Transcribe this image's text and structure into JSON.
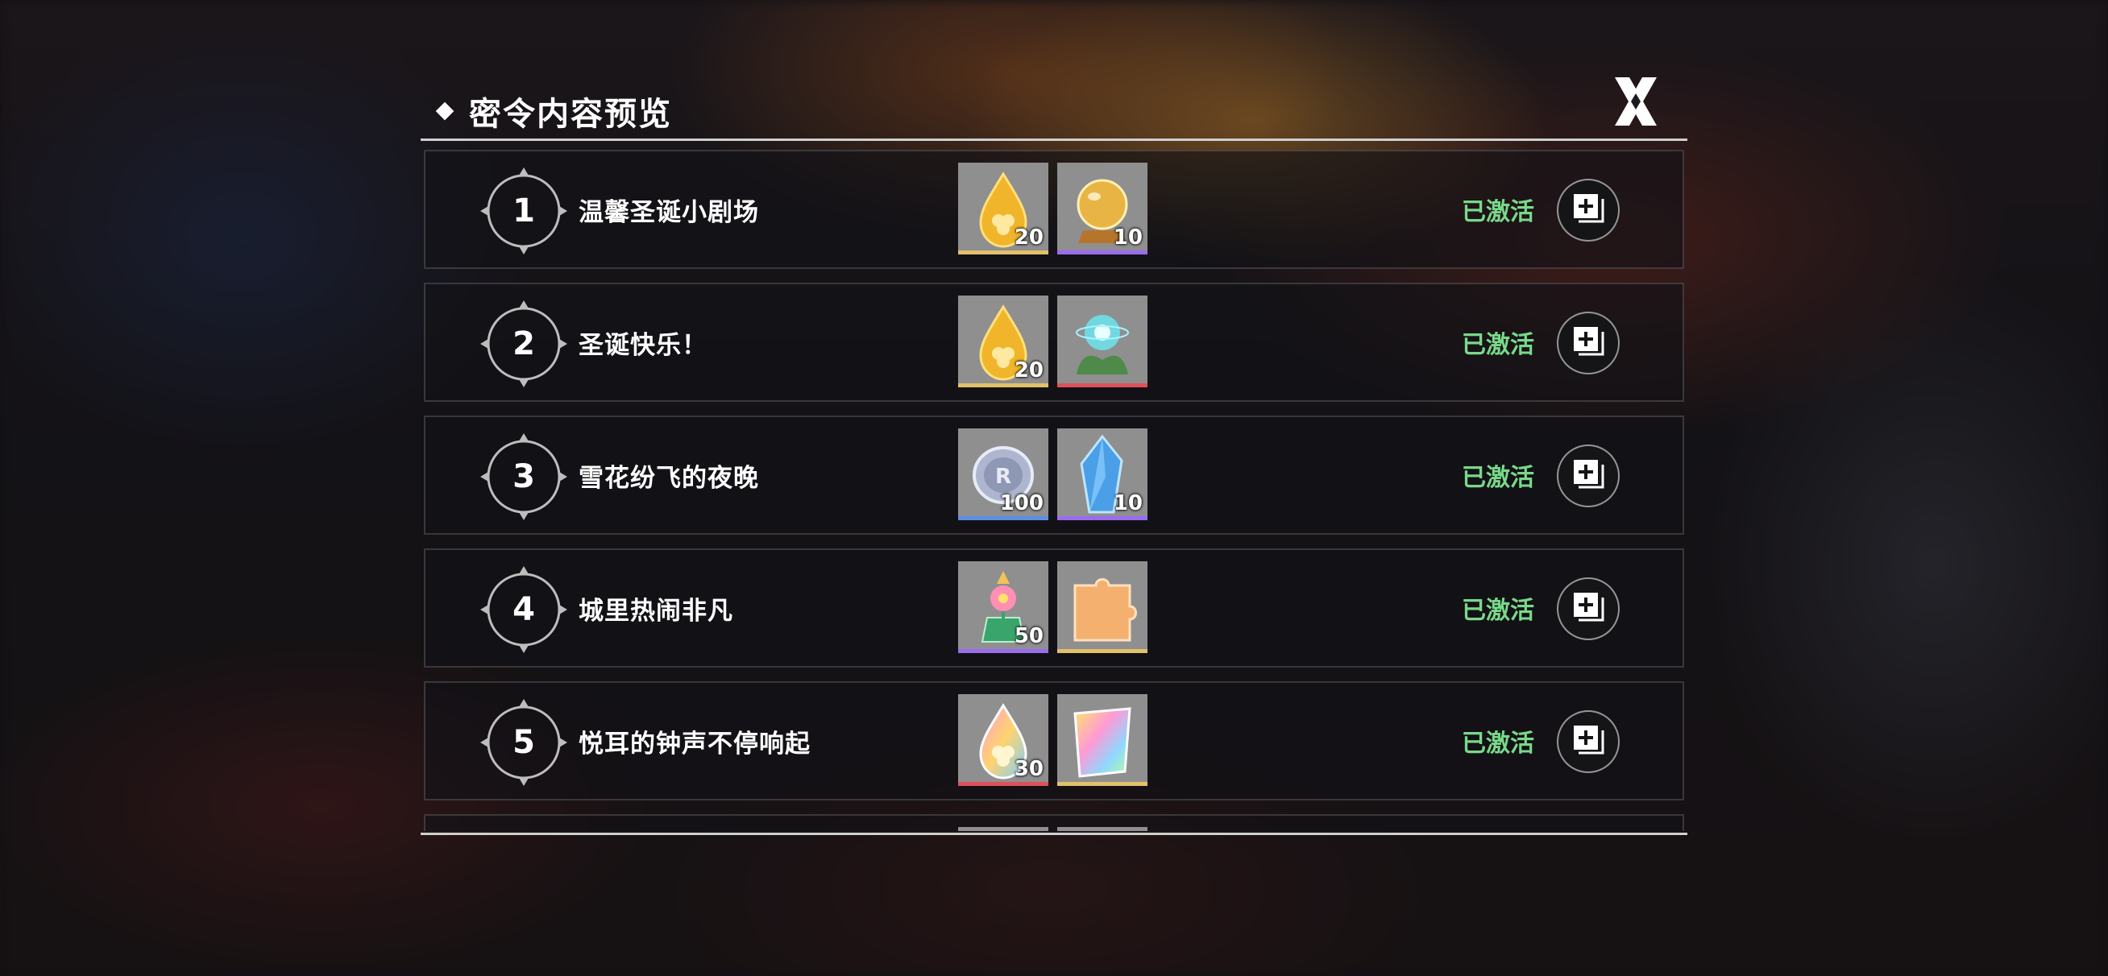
{
  "header": {
    "title": "密令内容预览",
    "close_label": "X"
  },
  "colors": {
    "status_green": "#78d98a",
    "rarity_gold": "#e2c16a",
    "rarity_purple": "#9b6cf0",
    "rarity_blue": "#5b8fe6",
    "rarity_red": "#e0505a"
  },
  "rows": [
    {
      "number": "1",
      "title": "温馨圣诞小剧场",
      "status": "已激活",
      "items": [
        {
          "icon": "golden-clover-drop-icon",
          "count": "20",
          "rarity": "gold"
        },
        {
          "icon": "crystal-ball-icon",
          "count": "10",
          "rarity": "purple"
        }
      ]
    },
    {
      "number": "2",
      "title": "圣诞快乐！",
      "status": "已激活",
      "items": [
        {
          "icon": "golden-clover-drop-icon",
          "count": "20",
          "rarity": "gold"
        },
        {
          "icon": "glowing-orb-plant-icon",
          "count": "",
          "rarity": "red"
        }
      ]
    },
    {
      "number": "3",
      "title": "雪花纷飞的夜晚",
      "status": "已激活",
      "items": [
        {
          "icon": "silver-coin-icon",
          "count": "100",
          "rarity": "blue"
        },
        {
          "icon": "blue-crystal-icon",
          "count": "10",
          "rarity": "purple"
        }
      ]
    },
    {
      "number": "4",
      "title": "城里热闹非凡",
      "status": "已激活",
      "items": [
        {
          "icon": "flower-vase-icon",
          "count": "50",
          "rarity": "purple"
        },
        {
          "icon": "puzzle-piece-icon",
          "count": "",
          "rarity": "gold"
        }
      ]
    },
    {
      "number": "5",
      "title": "悦耳的钟声不停响起",
      "status": "已激活",
      "items": [
        {
          "icon": "rainbow-clover-drop-icon",
          "count": "30",
          "rarity": "red"
        },
        {
          "icon": "rainbow-card-icon",
          "count": "",
          "rarity": "gold"
        }
      ]
    },
    {
      "number": "",
      "title": "",
      "status": "",
      "items": [
        {
          "icon": "",
          "count": "",
          "rarity": "gold"
        },
        {
          "icon": "",
          "count": "",
          "rarity": "gold"
        }
      ]
    }
  ]
}
